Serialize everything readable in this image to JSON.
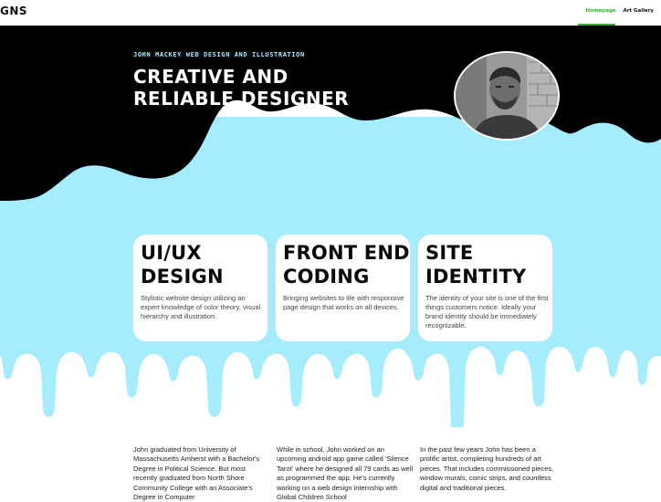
{
  "header": {
    "logo": "GNS",
    "nav": [
      {
        "label": "Homepage",
        "active": true
      },
      {
        "label": "Art Gallery",
        "active": false
      }
    ]
  },
  "hero": {
    "eyebrow": "John Mackey Web Design and Illustration",
    "title_line1": "Creative and",
    "title_line2": "Reliable Designer"
  },
  "cards": [
    {
      "title_line1": "UI/UX",
      "title_line2": "Design",
      "text": "Stylistic website design utilizing an expert knowledge of color theory, visual hierarchy and illustration."
    },
    {
      "title_line1": "Front End",
      "title_line2": "Coding",
      "text": "Bringing websites to life with responsive page design that works on all devices."
    },
    {
      "title_line1": "Site",
      "title_line2": "Identity",
      "text": "The identity of your site is one of the first things customers notice. Ideally your brand identity should be immediately recognizable."
    }
  ],
  "bio": [
    "John graduated from University of Massachusetts Amherst with a Bachelor's Degree in Political Science. But most recently graduated from North Shore Community College with an Associate's Degree in Computer",
    "While in school, John worked on an upcoming android app game called 'Silence Tarot' where he designed all 79 cards as well as  programmed the app. He's currently working on a web design internship with Global Children School",
    "In the past few years John has been a prolific artist, completing hundreds of art pieces. That includes commissioned pieces, window murals, comic strips, and countless digital and traditional pieces."
  ],
  "colors": {
    "accent_blue": "#a6ecff",
    "active_green": "#35b035",
    "dark": "#000000"
  }
}
